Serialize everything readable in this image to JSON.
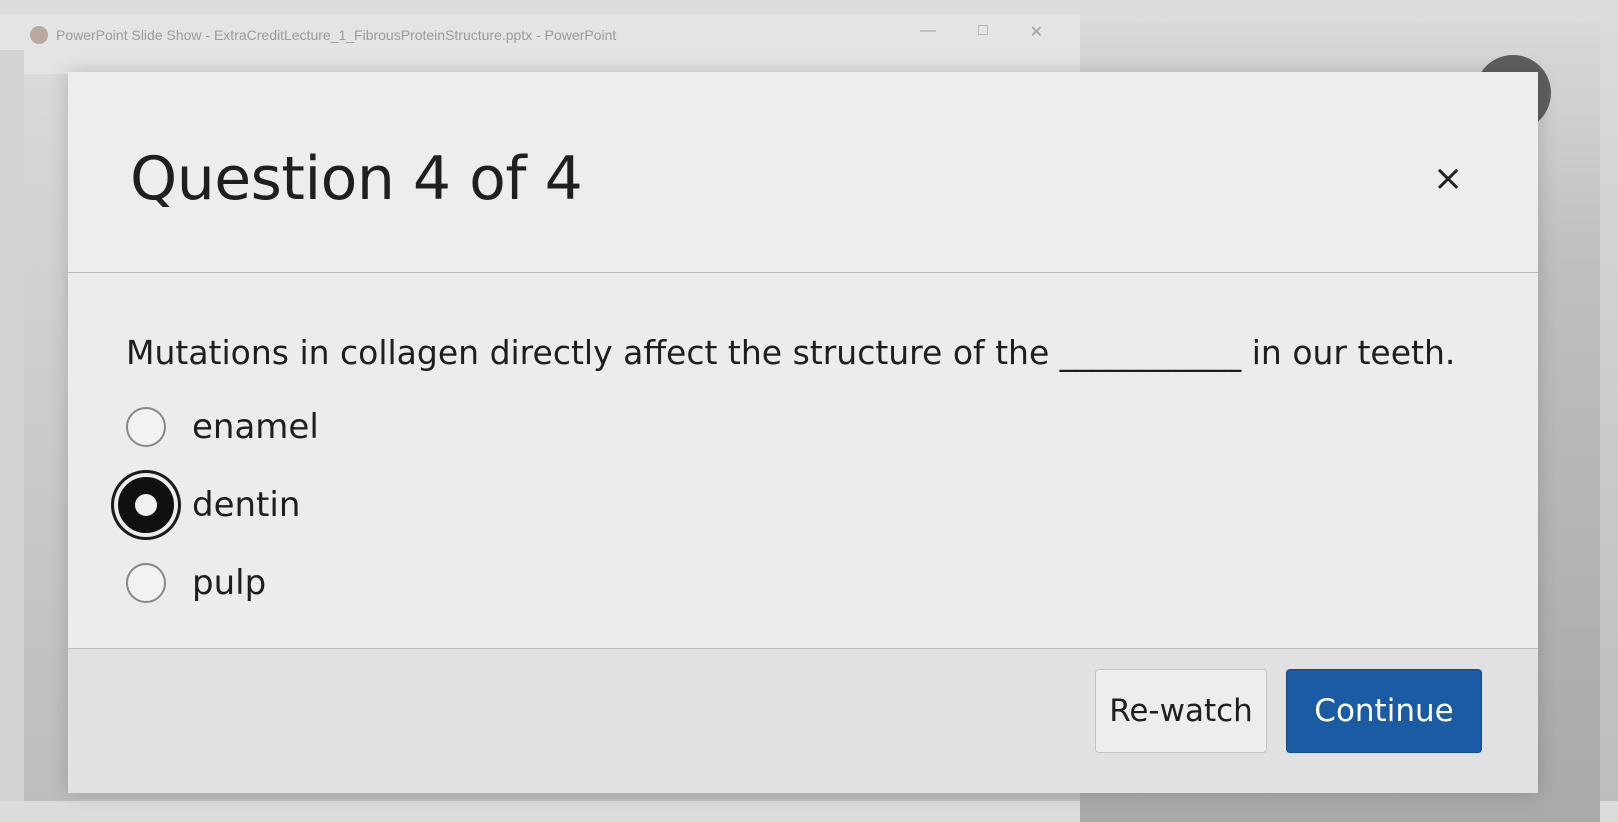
{
  "background_window": {
    "title": "PowerPoint Slide Show  -  ExtraCreditLecture_1_FibrousProteinStructure.pptx  -  PowerPoint",
    "controls": [
      "—",
      "□",
      "✕"
    ]
  },
  "modal": {
    "title": "Question 4 of 4",
    "close_icon": "×",
    "question": "Mutations in collagen directly affect the structure of the ___________ in our teeth.",
    "options": [
      {
        "label": "enamel",
        "selected": false
      },
      {
        "label": "dentin",
        "selected": true
      },
      {
        "label": "pulp",
        "selected": false
      }
    ],
    "buttons": {
      "rewatch": "Re-watch",
      "continue": "Continue"
    }
  },
  "colors": {
    "accent": "#1b5ba4",
    "dialog_bg": "#ececec"
  }
}
